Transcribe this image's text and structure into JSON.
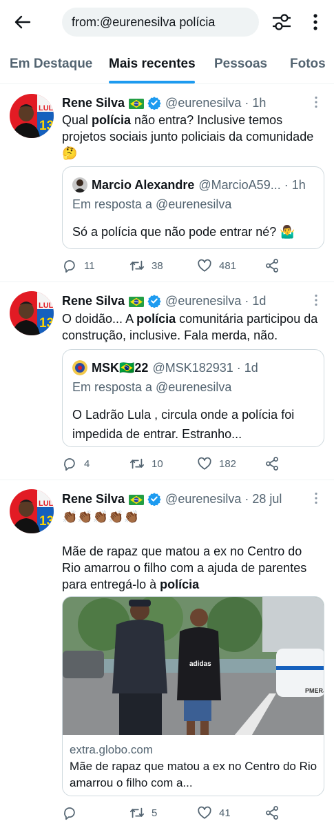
{
  "search": {
    "query": "from:@eurenesilva polícia"
  },
  "tabs": [
    {
      "label": "Em Destaque"
    },
    {
      "label": "Mais recentes"
    },
    {
      "label": "Pessoas"
    },
    {
      "label": "Fotos"
    }
  ],
  "colors": {
    "accent": "#1d9bf0",
    "secondary_text": "#536471",
    "border": "#cfd9de"
  },
  "tweets": [
    {
      "name": "Rene Silva",
      "handle": "@eurenesilva",
      "time": "1h",
      "text_pre": "Qual ",
      "text_bold": "polícia",
      "text_post": " não entra? Inclusive temos projetos sociais junto policiais da comunidade 🤔",
      "quote": {
        "name": "Marcio Alexandre",
        "handle": "@MarcioA59...",
        "time": "1h",
        "reply_to": "Em resposta a @eurenesilva",
        "text": "Só a polícia que não pode entrar né? 🤷‍♂️"
      },
      "replies": "11",
      "retweets": "38",
      "likes": "481"
    },
    {
      "name": "Rene Silva",
      "handle": "@eurenesilva",
      "time": "1d",
      "text_pre": "O doidão... A ",
      "text_bold": "polícia",
      "text_post": " comunitária participou da construção, inclusive. Fala merda, não.",
      "quote": {
        "name": "MSK🇧🇷22",
        "handle": "@MSK182931",
        "time": "1d",
        "reply_to": "Em resposta a @eurenesilva",
        "text": "O Ladrão Lula , circula onde a polícia foi impedida de entrar. Estranho..."
      },
      "replies": "4",
      "retweets": "10",
      "likes": "182"
    },
    {
      "name": "Rene Silva",
      "handle": "@eurenesilva",
      "time": "28 jul",
      "emoji_line": "👏🏾👏🏾👏🏾👏🏾👏🏾",
      "text_pre": "Mãe de rapaz que matou a ex no Centro do Rio amarrou o filho com a ajuda de parentes para entregá-lo à ",
      "text_bold": "polícia",
      "text_post": "",
      "card": {
        "domain": "extra.globo.com",
        "title": "Mãe de rapaz que matou a ex no Centro do Rio amarrou o filho com a...",
        "image_text_pmerj": "PMERJ"
      },
      "replies": "",
      "retweets": "5",
      "likes": "41"
    }
  ]
}
